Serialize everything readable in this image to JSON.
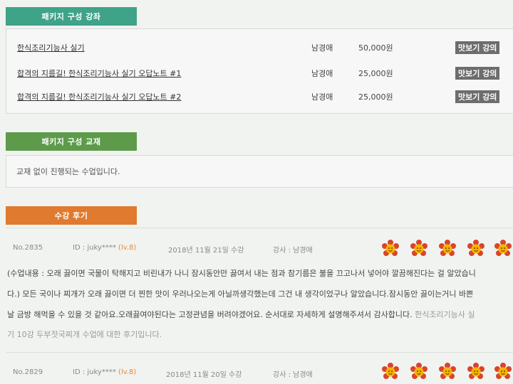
{
  "sections": {
    "courses_tab": "패키지 구성 강좌",
    "books_tab": "패키지 구성 교재",
    "reviews_tab": "수강 후기"
  },
  "courses": [
    {
      "title": "한식조리기능사 실기",
      "teacher": "남경애",
      "price": "50,000원",
      "button": "맛보기 강의"
    },
    {
      "title": "합격의 지름길! 한식조리기능사 실기 오답노트 #1",
      "teacher": "남경애",
      "price": "25,000원",
      "button": "맛보기 강의"
    },
    {
      "title": "합격의 지름길! 한식조리기능사 실기 오답노트 #2",
      "teacher": "남경애",
      "price": "25,000원",
      "button": "맛보기 강의"
    }
  ],
  "books_notice": "교재 없이 진행되는 수업입니다.",
  "reviews": [
    {
      "no": "No.2835",
      "id": "ID : juky****",
      "level": "(lv.8)",
      "date": "2018년 11월 21일 수강",
      "teacher": "강사 : 남경애",
      "lines": [
        "(수업내용 : 오래 끓이면 국물이 탁해지고 비린내가 나니 잠시동안만 끓여서 내는 점과 참기름은 불을 끄고나서 넣어야 깔끔해진다는 걸 알았습니",
        "다.) 모든 국이나 찌개가 오래 끓이면 더 찐한 맛이 우러나오는게 아닐까생각했는데 그건 내 생각이었구나 알았습니다.잠시동안 끓이는거니 바쁜",
        "날 금방 해먹을 수 있을 것 같아요.오래끓여야된다는 고정관념을 버려야겠어요. 순서대로 자세하게 설명해주셔서 감사합니다.",
        "기 10강 두부젓국찌개 수업에 대한 후기입니다."
      ],
      "course_ref": " 한식조리기능사 실",
      "stars": 5
    },
    {
      "no": "No.2829",
      "id": "ID : juky****",
      "level": "(lv.8)",
      "date": "2018년 11월 20일 수강",
      "teacher": "강사 : 남경애",
      "stars": 5
    }
  ],
  "colors": {
    "teal_tab": "#3fa388",
    "green_tab": "#5d9b4a",
    "orange_tab": "#e07a2e",
    "button_bg": "#6d6d6d",
    "flower_petal": "#d9452a",
    "flower_face": "#f5b400"
  }
}
